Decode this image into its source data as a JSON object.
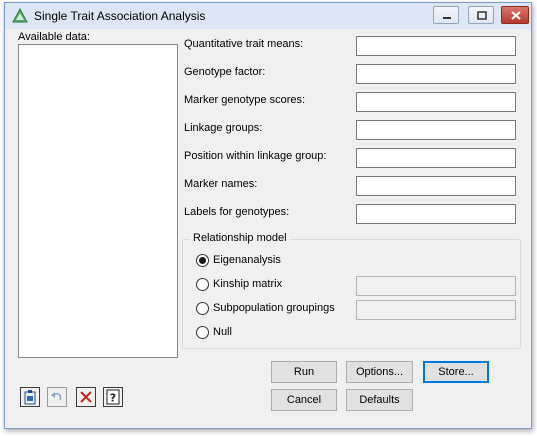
{
  "window": {
    "title": "Single Trait Association Analysis",
    "icon": "triangle-app-icon",
    "controls": [
      "minimize-icon",
      "maximize-icon",
      "close-icon"
    ]
  },
  "available_data": {
    "label": "Available data:",
    "items": []
  },
  "fields": [
    {
      "label": "Quantitative trait means:",
      "value": ""
    },
    {
      "label": "Genotype factor:",
      "value": ""
    },
    {
      "label": "Marker genotype scores:",
      "value": ""
    },
    {
      "label": "Linkage groups:",
      "value": ""
    },
    {
      "label": "Position within linkage group:",
      "value": ""
    },
    {
      "label": "Marker names:",
      "value": ""
    },
    {
      "label": "Labels for genotypes:",
      "value": ""
    }
  ],
  "relationship_model": {
    "title": "Relationship model",
    "options": [
      {
        "label": "Eigenanalysis",
        "checked": true,
        "has_field": false
      },
      {
        "label": "Kinship matrix",
        "checked": false,
        "has_field": true,
        "field_value": ""
      },
      {
        "label": "Subpopulation groupings",
        "checked": false,
        "has_field": true,
        "field_value": ""
      },
      {
        "label": "Null",
        "checked": false,
        "has_field": false
      }
    ]
  },
  "buttons": {
    "run": "Run",
    "options": "Options...",
    "store": "Store...",
    "cancel": "Cancel",
    "defaults": "Defaults"
  },
  "toolbar": {
    "icons": [
      "clipboard-icon",
      "undo-icon",
      "clear-icon",
      "help-icon"
    ]
  },
  "colors": {
    "titlebar": "#dce6f4",
    "window_bg": "#f0f0f0",
    "accent": "#0078d7",
    "clear_red": "#c42b1c"
  }
}
